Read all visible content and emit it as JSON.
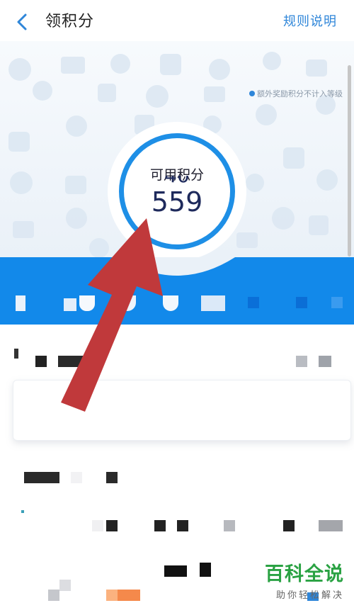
{
  "header": {
    "back_icon": "chevron-left-icon",
    "title": "领积分",
    "rules_link": "规则说明"
  },
  "hero": {
    "note": "额外奖励积分不计入等级",
    "points_label": "可用积分",
    "points_value": "559",
    "points_ghost": "40"
  },
  "watermark": {
    "logo": "百科全说",
    "sub": "助你轻松解决"
  },
  "colors": {
    "accent": "#1e8fe6",
    "band": "#1289ea",
    "link": "#2f86d9",
    "arrow": "#c0393b",
    "watermark": "#2aa243"
  }
}
